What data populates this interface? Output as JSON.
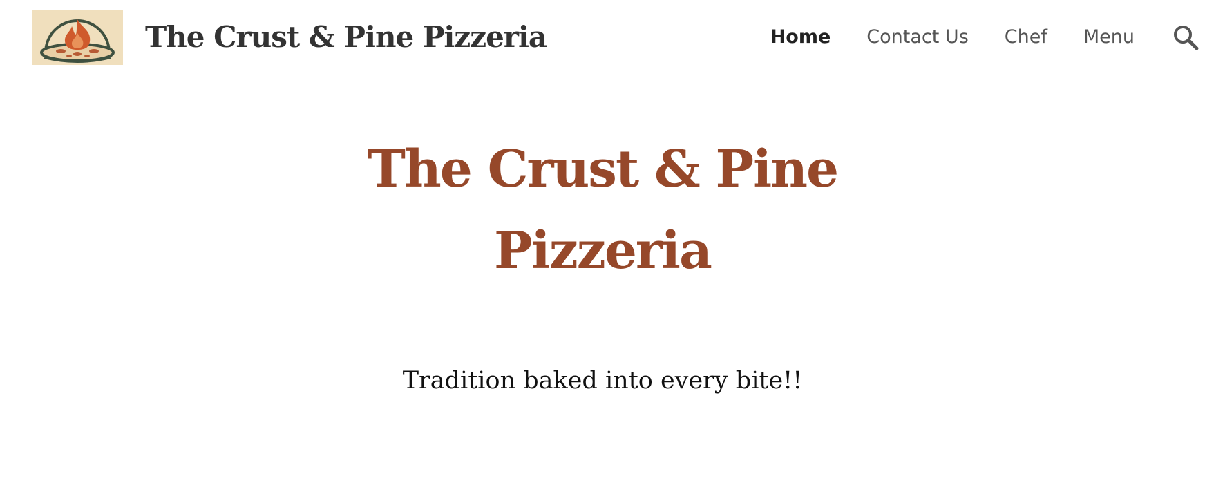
{
  "header": {
    "logo_icon": "pizza-oven-flame-logo-icon",
    "site_title": "The Crust & Pine Pizzeria",
    "nav": [
      {
        "label": "Home",
        "active": true
      },
      {
        "label": "Contact Us",
        "active": false
      },
      {
        "label": "Chef",
        "active": false
      },
      {
        "label": "Menu",
        "active": false
      }
    ],
    "search_icon": "search-icon"
  },
  "hero": {
    "title_line1": "The Crust & Pine",
    "title_line2": "Pizzeria",
    "tagline": "Tradition baked into every bite!!"
  },
  "colors": {
    "accent": "#96482a",
    "logo_background": "#f0dfbd",
    "header_text": "#333333",
    "nav_text": "#555555"
  }
}
